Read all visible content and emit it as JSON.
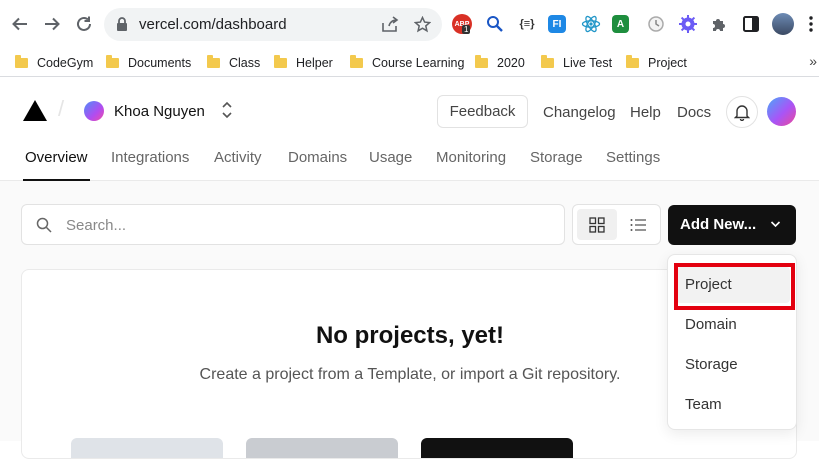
{
  "browser": {
    "url": "vercel.com/dashboard",
    "bookmarks": [
      "CodeGym",
      "Documents",
      "Class",
      "Helper",
      "Course Learning",
      "2020",
      "Live Test",
      "Project"
    ],
    "extension_badge": "1",
    "extension_label": "{≡}",
    "more_bookmarks": "»"
  },
  "header": {
    "team_name": "Khoa Nguyen",
    "feedback_label": "Feedback",
    "links": [
      "Changelog",
      "Help",
      "Docs"
    ]
  },
  "tabs": [
    "Overview",
    "Integrations",
    "Activity",
    "Domains",
    "Usage",
    "Monitoring",
    "Storage",
    "Settings"
  ],
  "active_tab": "Overview",
  "toolbar": {
    "search_placeholder": "Search...",
    "add_new_label": "Add New..."
  },
  "empty_state": {
    "title": "No projects, yet!",
    "subtitle": "Create a project from a Template, or import a Git repository."
  },
  "dropdown": {
    "items": [
      "Project",
      "Domain",
      "Storage",
      "Team"
    ],
    "highlighted": "Project"
  },
  "colors": {
    "highlight_box": "#e3000f",
    "add_button_bg": "#111111"
  }
}
